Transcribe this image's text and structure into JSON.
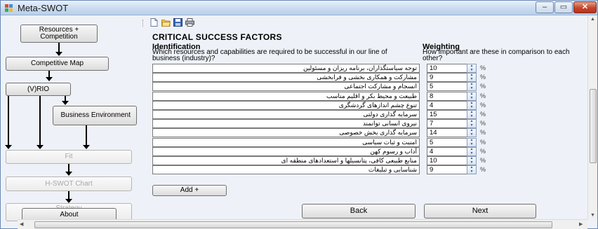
{
  "window": {
    "title": "Meta-SWOT",
    "minimize_glyph": "–",
    "maximize_glyph": "▭",
    "close_glyph": "✕",
    "accent_close": "#c3462a"
  },
  "nav": {
    "resources_competition": "Resources + Competition",
    "competitive_map": "Competitive Map",
    "vrio": "(V)RIO",
    "business_environment": "Business Environment",
    "fit": "Fit",
    "h_swot_chart": "H-SWOT Chart",
    "strategy_development": "Strategy Development",
    "about": "About"
  },
  "toolbar": {
    "icons": [
      "new-file-icon",
      "open-folder-icon",
      "save-icon",
      "print-icon"
    ]
  },
  "content": {
    "heading": "CRITICAL SUCCESS FACTORS",
    "identification_label": "Identification",
    "identification_question": "Which resources and capabilities are required to be successful in our line of business (industry)?",
    "weighting_label": "Weighting",
    "weighting_question": "How important are these in comparison to each other?",
    "percent_symbol": "%",
    "factors": [
      {
        "text": "توجه سیاستگذاران، برنامه ریزان و مسئولین",
        "weight": "10"
      },
      {
        "text": "مشارکت و همکاری بخشی و فرابخشی",
        "weight": "9"
      },
      {
        "text": "انسجام و مشارکت اجتماعی",
        "weight": "5"
      },
      {
        "text": "طبیعت و محیط بکر و اقلیم مناسب",
        "weight": "8"
      },
      {
        "text": "تنوع چشم اندازهای گردشگری",
        "weight": "4"
      },
      {
        "text": "سرمایه گذاری دولتی",
        "weight": "15"
      },
      {
        "text": "نیروی انسانی توانمند",
        "weight": "7"
      },
      {
        "text": "سرمایه گذاری بخش خصوصی",
        "weight": "14"
      },
      {
        "text": "امنیت و ثبات سیاسی",
        "weight": "5"
      },
      {
        "text": "آداب و رسوم کهن",
        "weight": "4"
      },
      {
        "text": "منابع طبیعی کافی، پتانسیلها و استعدادهای منطقه ای",
        "weight": "10"
      },
      {
        "text": "شناسایی و تبلیغات",
        "weight": "9"
      }
    ],
    "add_button": "Add +",
    "back_button": "Back",
    "next_button": "Next"
  }
}
